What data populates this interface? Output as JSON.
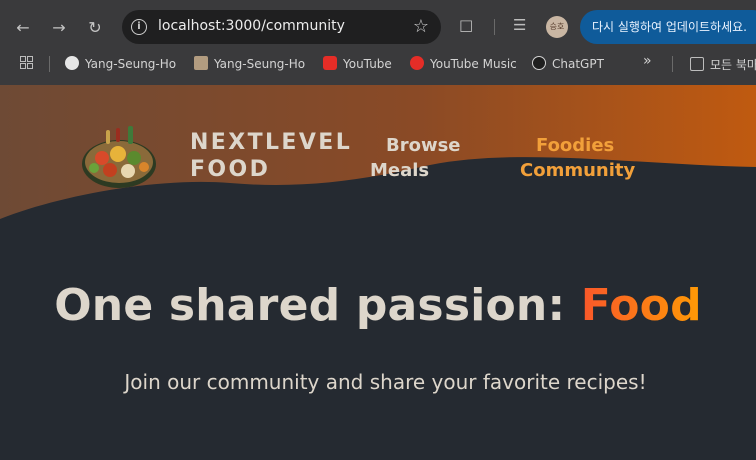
{
  "browser": {
    "url": "localhost:3000/community",
    "update_button": "다시 실행하여 업데이트하세요.",
    "avatar_text": "승호",
    "bookmarks": [
      {
        "label": "Yang-Seung-Ho",
        "icon": "github-icon"
      },
      {
        "label": "Yang-Seung-Ho",
        "icon": "profile-photo-icon"
      },
      {
        "label": "YouTube",
        "icon": "youtube-icon"
      },
      {
        "label": "YouTube Music",
        "icon": "youtube-music-icon"
      },
      {
        "label": "ChatGPT",
        "icon": "chatgpt-icon"
      }
    ],
    "overflow_label": "»",
    "all_bookmarks_label": "모든 북마"
  },
  "site": {
    "brand_line1": "NEXTLEVEL",
    "brand_line2": "FOOD",
    "nav": {
      "browse_line1": "Browse",
      "browse_line2": "Meals",
      "foodies_line1": "Foodies",
      "foodies_line2": "Community"
    }
  },
  "hero": {
    "title_main": "One shared passion: ",
    "title_accent": "Food",
    "subtitle": "Join our community and share your favorite recipes!"
  },
  "colors": {
    "page_bg": "#252a31",
    "header_gradient_start": "#6e4a35",
    "header_gradient_end": "#c05a10",
    "text": "#ddd6cb",
    "accent_start": "#f9572a",
    "accent_end": "#ff9b05",
    "active_nav": "#f2a03a"
  }
}
